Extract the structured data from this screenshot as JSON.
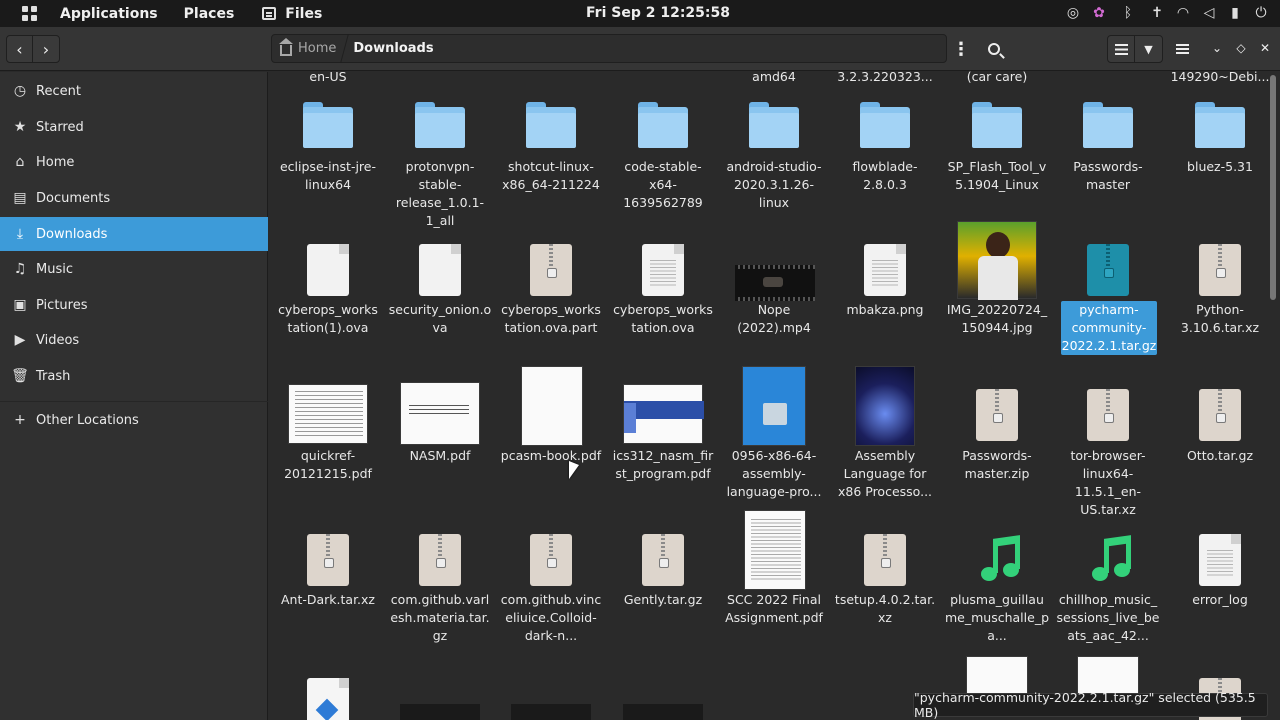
{
  "topbar": {
    "applications": "Applications",
    "places": "Places",
    "files": "Files",
    "clock": "Fri Sep 2  12:25:58"
  },
  "pathbar": {
    "home": "Home",
    "current": "Downloads"
  },
  "sidebar": {
    "items": [
      {
        "label": "Recent",
        "icon": "clock-icon"
      },
      {
        "label": "Starred",
        "icon": "star-icon"
      },
      {
        "label": "Home",
        "icon": "home-icon"
      },
      {
        "label": "Documents",
        "icon": "document-icon"
      },
      {
        "label": "Downloads",
        "icon": "download-icon"
      },
      {
        "label": "Music",
        "icon": "music-icon"
      },
      {
        "label": "Pictures",
        "icon": "picture-icon"
      },
      {
        "label": "Videos",
        "icon": "video-icon"
      },
      {
        "label": "Trash",
        "icon": "trash-icon"
      },
      {
        "label": "Other Locations",
        "icon": "plus-icon"
      }
    ]
  },
  "files": {
    "row0": [
      "en-US",
      "amd64",
      "3.2.3.220323...",
      "(car care)",
      "149290~Debi..."
    ],
    "row1": [
      "eclipse-inst-jre-linux64",
      "protonvpn-stable-release_1.0.1-1_all",
      "shotcut-linux-x86_64-211224",
      "code-stable-x64-1639562789",
      "android-studio-2020.3.1.26-linux",
      "flowblade-2.8.0.3",
      "SP_Flash_Tool_v5.1904_Linux",
      "Passwords-master",
      "bluez-5.31"
    ],
    "row2": [
      "cyberops_workstation(1).ova",
      "security_onion.ova",
      "cyberops_workstation.ova.part",
      "cyberops_workstation.ova",
      "Nope (2022).mp4",
      "mbakza.png",
      "IMG_20220724_150944.jpg",
      "pycharm-community-2022.2.1.tar.gz",
      "Python-3.10.6.tar.xz"
    ],
    "row3": [
      "quickref-20121215.pdf",
      "NASM.pdf",
      "pcasm-book.pdf",
      "ics312_nasm_first_program.pdf",
      "0956-x86-64-assembly-language-pro...",
      "Assembly Language for x86 Processo...",
      "Passwords-master.zip",
      "tor-browser-linux64-11.5.1_en-US.tar.xz",
      "Otto.tar.gz"
    ],
    "row4": [
      "Ant-Dark.tar.xz",
      "com.github.varlesh.materia.tar.gz",
      "com.github.vinceliuice.Colloid-dark-n...",
      "Gently.tar.gz",
      "SCC 2022 Final Assignment.pdf",
      "tsetup.4.0.2.tar.xz",
      "plusma_guillaume_muschalle_pa...",
      "chillhop_music_sessions_live_beats_aac_42...",
      "error_log"
    ]
  },
  "status": "\"pycharm-community-2022.2.1.tar.gz\" selected (535.5 MB)",
  "colors": {
    "accent": "#3d9bd9",
    "folder": "#a3d3f5",
    "music_note": "#33d17a"
  }
}
